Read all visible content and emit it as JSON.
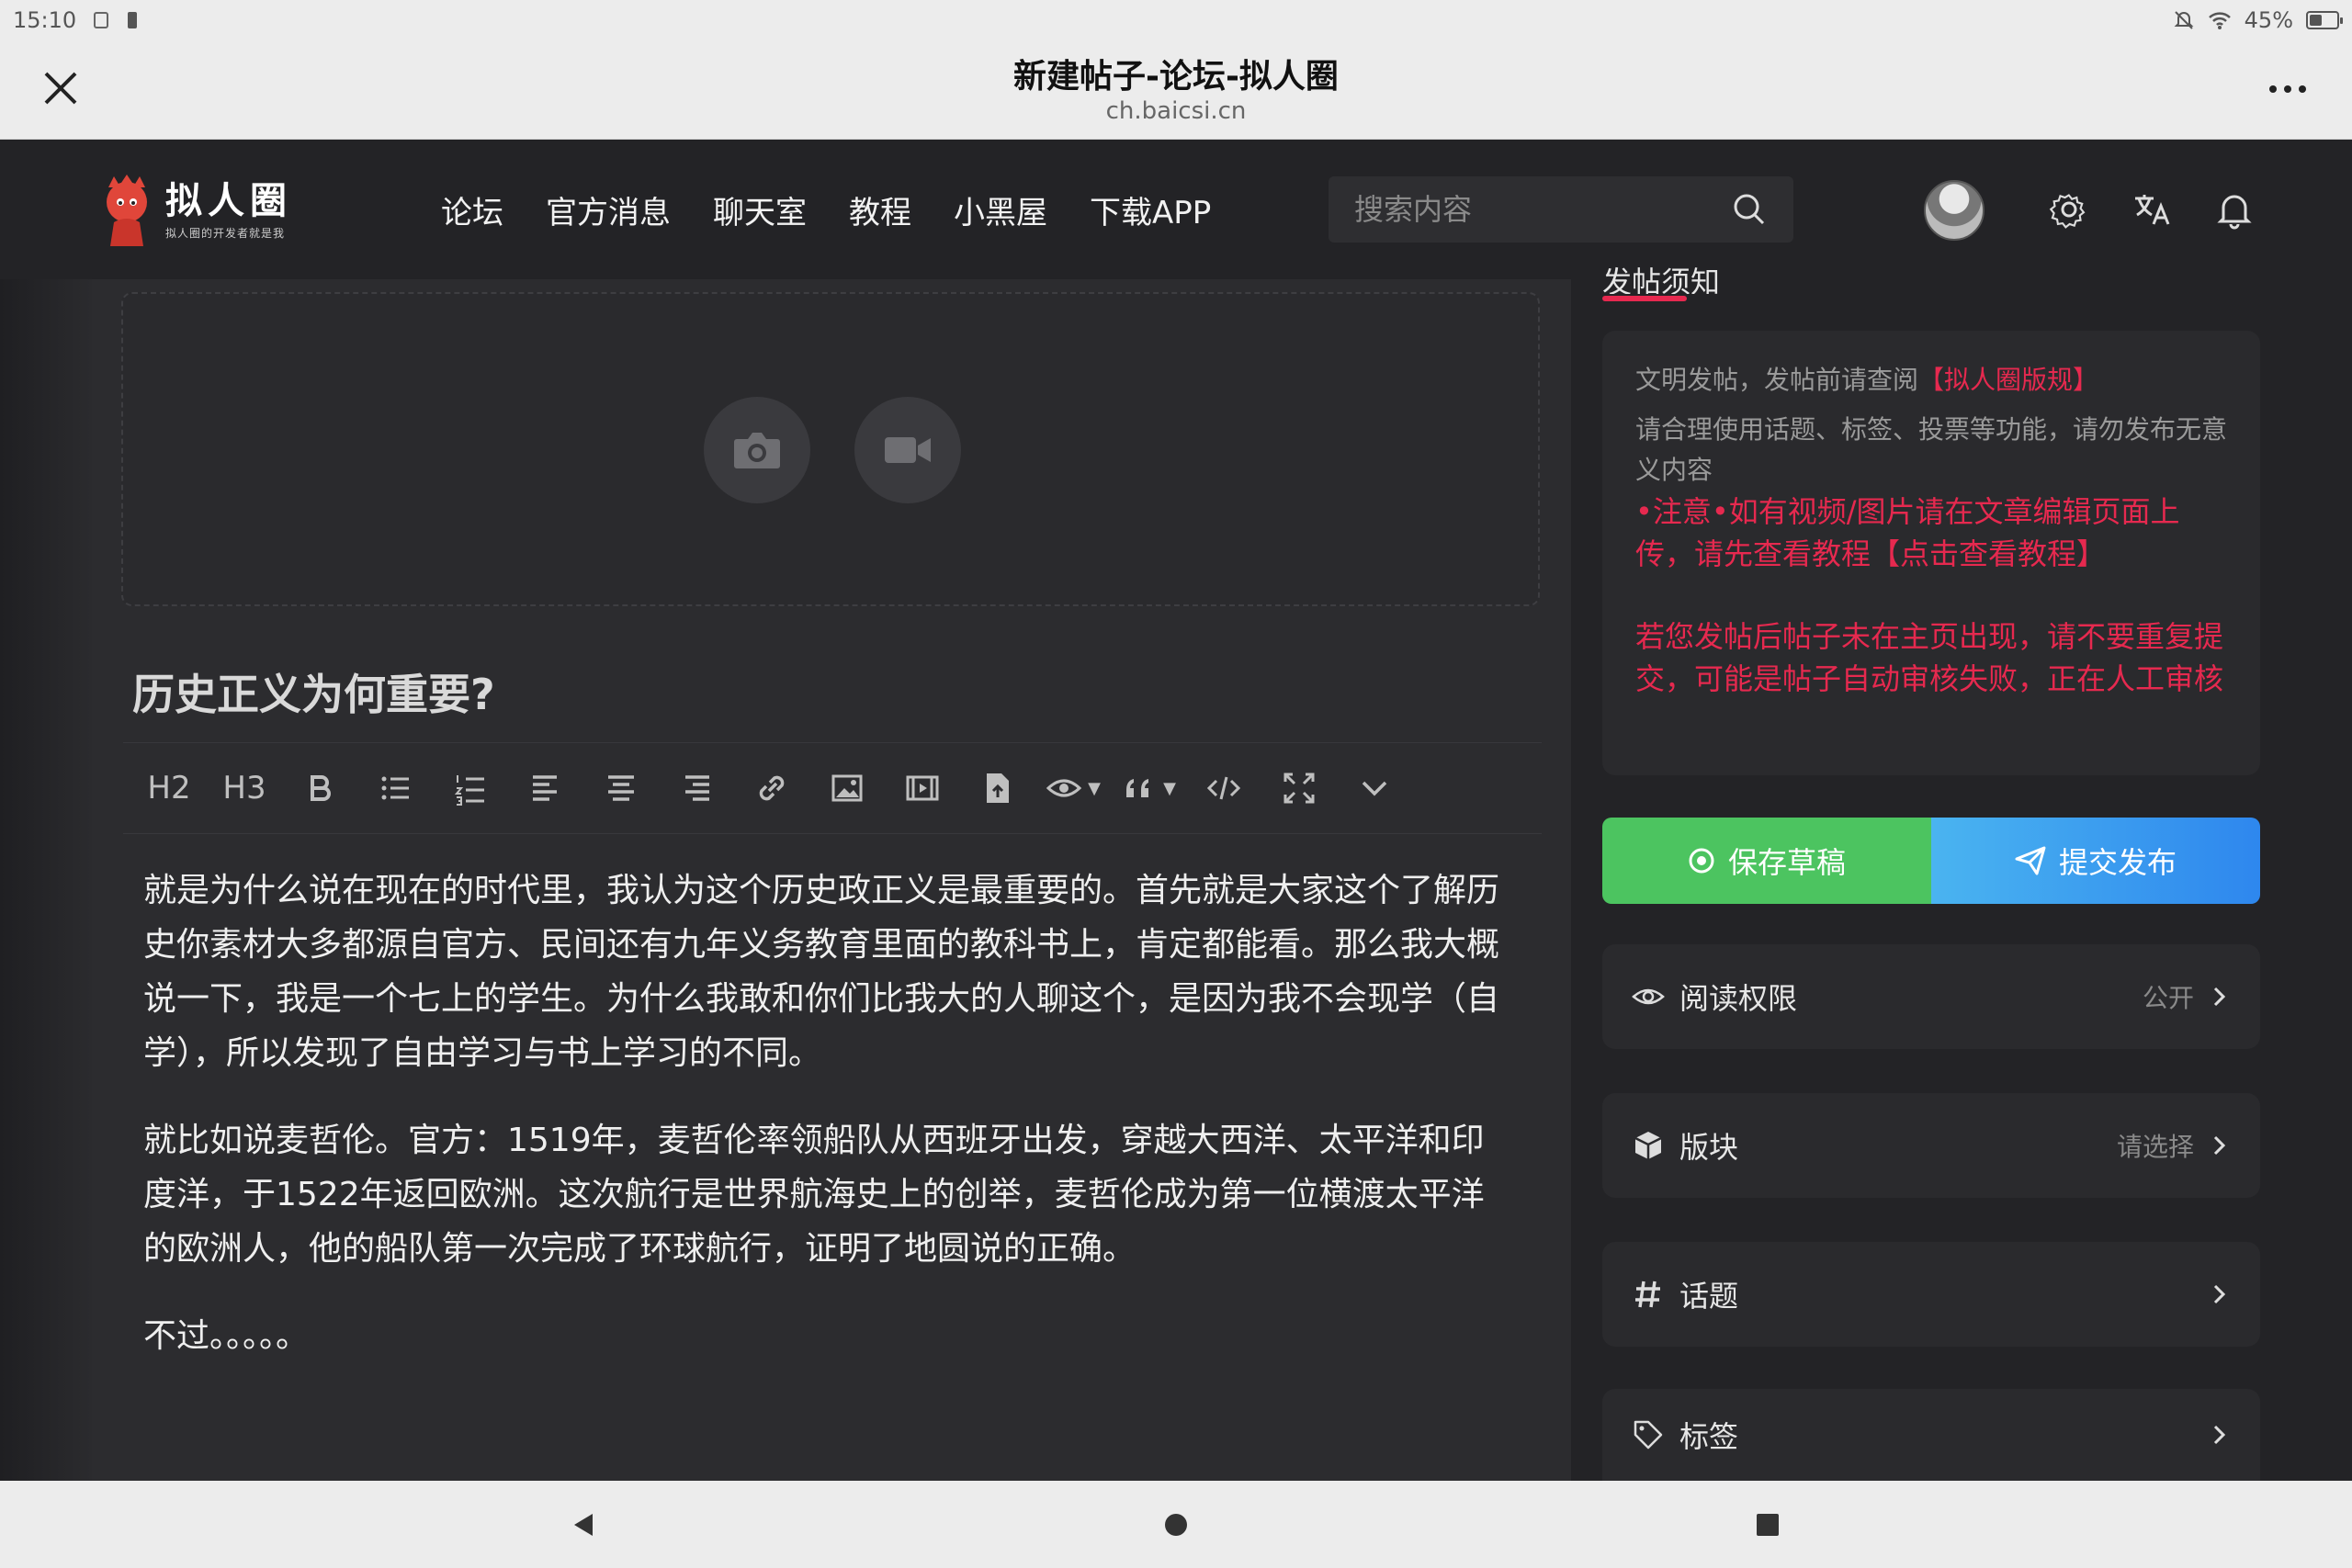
{
  "status_bar": {
    "time": "15:10",
    "battery": "45%",
    "battery_level": 0.45
  },
  "browser": {
    "title": "新建帖子-论坛-拟人圈",
    "url": "ch.baicsi.cn"
  },
  "header": {
    "logo_name": "拟人圈",
    "logo_tagline": "拟人圈的开发者就是我",
    "nav": [
      "论坛",
      "官方消息",
      "聊天室",
      "教程",
      "小黑屋",
      "下载APP"
    ],
    "search_placeholder": "搜索内容"
  },
  "editor": {
    "title": "历史正义为何重要?",
    "toolbar": {
      "h2": "H2",
      "h3": "H3"
    },
    "paragraphs": [
      "就是为什么说在现在的时代里，我认为这个历史政正义是最重要的。首先就是大家这个了解历史你素材大多都源自官方、民间还有九年义务教育里面的教科书上，肯定都能看。那么我大概说一下，我是一个七上的学生。为什么我敢和你们比我大的人聊这个，是因为我不会现学（自学），所以发现了自由学习与书上学习的不同。",
      "就比如说麦哲伦。官方：1519年，麦哲伦率领船队从西班牙出发，穿越大西洋、太平洋和印度洋，于1522年返回欧洲。这次航行是世界航海史上的创举，麦哲伦成为第一位横渡太平洋的欧洲人，他的船队第一次完成了环球航行，证明了地圆说的正确。",
      "不过。。。。。"
    ]
  },
  "notice": {
    "heading": "发帖须知",
    "line1_gray": "文明发帖，发帖前请查阅",
    "line1_red": "【拟人圈版规】",
    "line2": "请合理使用话题、标签、投票等功能，请勿发布无意义内容",
    "line3": "•注意•如有视频/图片请在文章编辑页面上传，请先查看教程【点击查看教程】",
    "line4": "若您发帖后帖子未在主页出现，请不要重复提交，可能是帖子自动审核失败，正在人工审核"
  },
  "actions": {
    "save": "保存草稿",
    "publish": "提交发布"
  },
  "options": [
    {
      "label": "阅读权限",
      "value": "公开",
      "icon": "eye-icon"
    },
    {
      "label": "版块",
      "value": "请选择",
      "icon": "cube-icon"
    },
    {
      "label": "话题",
      "value": "",
      "icon": "hash-icon"
    },
    {
      "label": "标签",
      "value": "",
      "icon": "tag-icon"
    }
  ],
  "colors": {
    "accent_red": "#e6294f",
    "save_green": "#4cc460",
    "publish_blue": "#2e87ee"
  }
}
